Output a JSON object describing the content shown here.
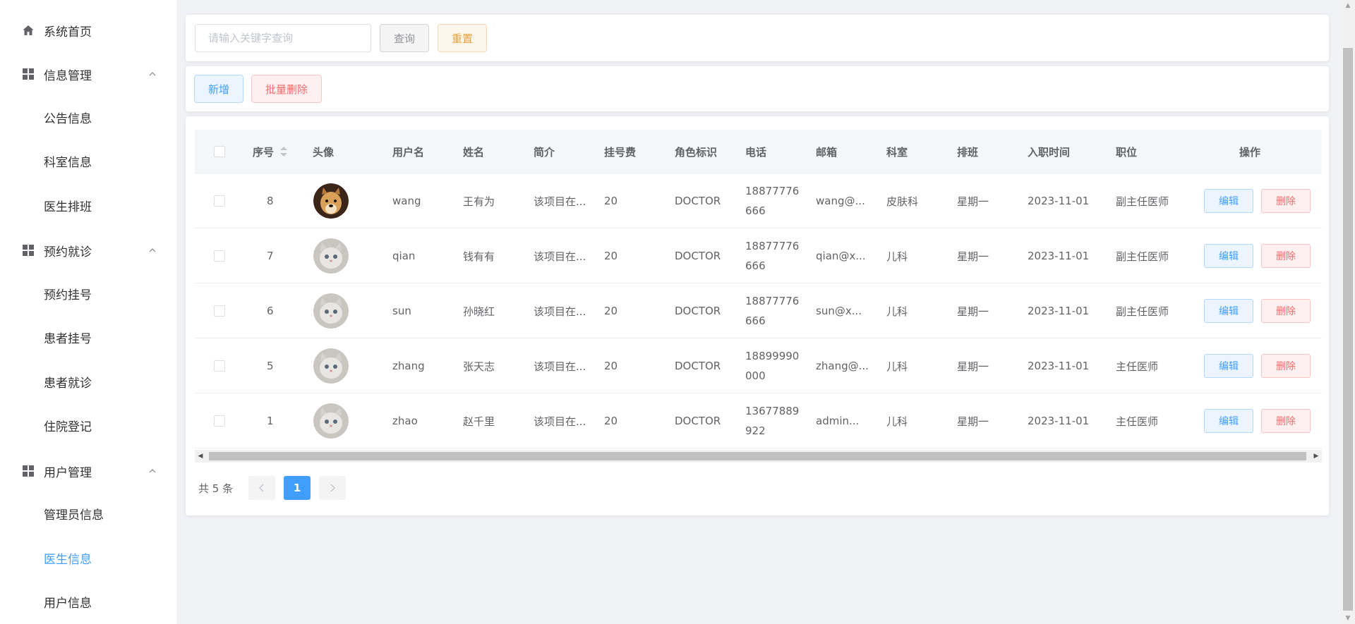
{
  "sidebar": {
    "items": [
      {
        "label": "系统首页",
        "icon": "home-icon",
        "type": "top"
      },
      {
        "label": "信息管理",
        "icon": "grid-icon",
        "type": "group"
      },
      {
        "label": "公告信息",
        "type": "sub"
      },
      {
        "label": "科室信息",
        "type": "sub"
      },
      {
        "label": "医生排班",
        "type": "sub"
      },
      {
        "label": "预约就诊",
        "icon": "grid-icon",
        "type": "group"
      },
      {
        "label": "预约挂号",
        "type": "sub"
      },
      {
        "label": "患者挂号",
        "type": "sub"
      },
      {
        "label": "患者就诊",
        "type": "sub"
      },
      {
        "label": "住院登记",
        "type": "sub"
      },
      {
        "label": "用户管理",
        "icon": "grid-icon",
        "type": "group"
      },
      {
        "label": "管理员信息",
        "type": "sub"
      },
      {
        "label": "医生信息",
        "type": "sub",
        "active": true
      },
      {
        "label": "用户信息",
        "type": "sub"
      }
    ]
  },
  "search": {
    "placeholder": "请输入关键字查询",
    "query_label": "查询",
    "reset_label": "重置"
  },
  "actions": {
    "add_label": "新增",
    "batch_delete_label": "批量删除"
  },
  "table": {
    "columns": [
      "序号",
      "头像",
      "用户名",
      "姓名",
      "简介",
      "挂号费",
      "角色标识",
      "电话",
      "邮箱",
      "科室",
      "排班",
      "入职时间",
      "职位",
      "操作"
    ],
    "rows": [
      {
        "id": "8",
        "avatar": "dog",
        "username": "wang",
        "name": "王有为",
        "intro": "该项目在...",
        "fee": "20",
        "role": "DOCTOR",
        "phone_a": "18877776",
        "phone_b": "666",
        "email": "wang@...",
        "dept": "皮肤科",
        "shift": "星期一",
        "date": "2023-11-01",
        "title": "副主任医师"
      },
      {
        "id": "7",
        "avatar": "cat",
        "username": "qian",
        "name": "钱有有",
        "intro": "该项目在...",
        "fee": "20",
        "role": "DOCTOR",
        "phone_a": "18877776",
        "phone_b": "666",
        "email": "qian@x...",
        "dept": "儿科",
        "shift": "星期一",
        "date": "2023-11-01",
        "title": "副主任医师"
      },
      {
        "id": "6",
        "avatar": "cat",
        "username": "sun",
        "name": "孙晓红",
        "intro": "该项目在...",
        "fee": "20",
        "role": "DOCTOR",
        "phone_a": "18877776",
        "phone_b": "666",
        "email": "sun@x...",
        "dept": "儿科",
        "shift": "星期一",
        "date": "2023-11-01",
        "title": "副主任医师"
      },
      {
        "id": "5",
        "avatar": "cat",
        "username": "zhang",
        "name": "张天志",
        "intro": "该项目在...",
        "fee": "20",
        "role": "DOCTOR",
        "phone_a": "18899990",
        "phone_b": "000",
        "email": "zhang@...",
        "dept": "儿科",
        "shift": "星期一",
        "date": "2023-11-01",
        "title": "主任医师"
      },
      {
        "id": "1",
        "avatar": "cat",
        "username": "zhao",
        "name": "赵千里",
        "intro": "该项目在...",
        "fee": "20",
        "role": "DOCTOR",
        "phone_a": "13677889",
        "phone_b": "922",
        "email": "admin...",
        "dept": "儿科",
        "shift": "星期一",
        "date": "2023-11-01",
        "title": "主任医师"
      }
    ],
    "edit_label": "编辑",
    "delete_label": "删除"
  },
  "pagination": {
    "total_text": "共 5 条",
    "current_page": "1"
  },
  "colors": {
    "primary": "#409eff",
    "danger": "#f56c6c",
    "warning": "#e6a23c"
  }
}
